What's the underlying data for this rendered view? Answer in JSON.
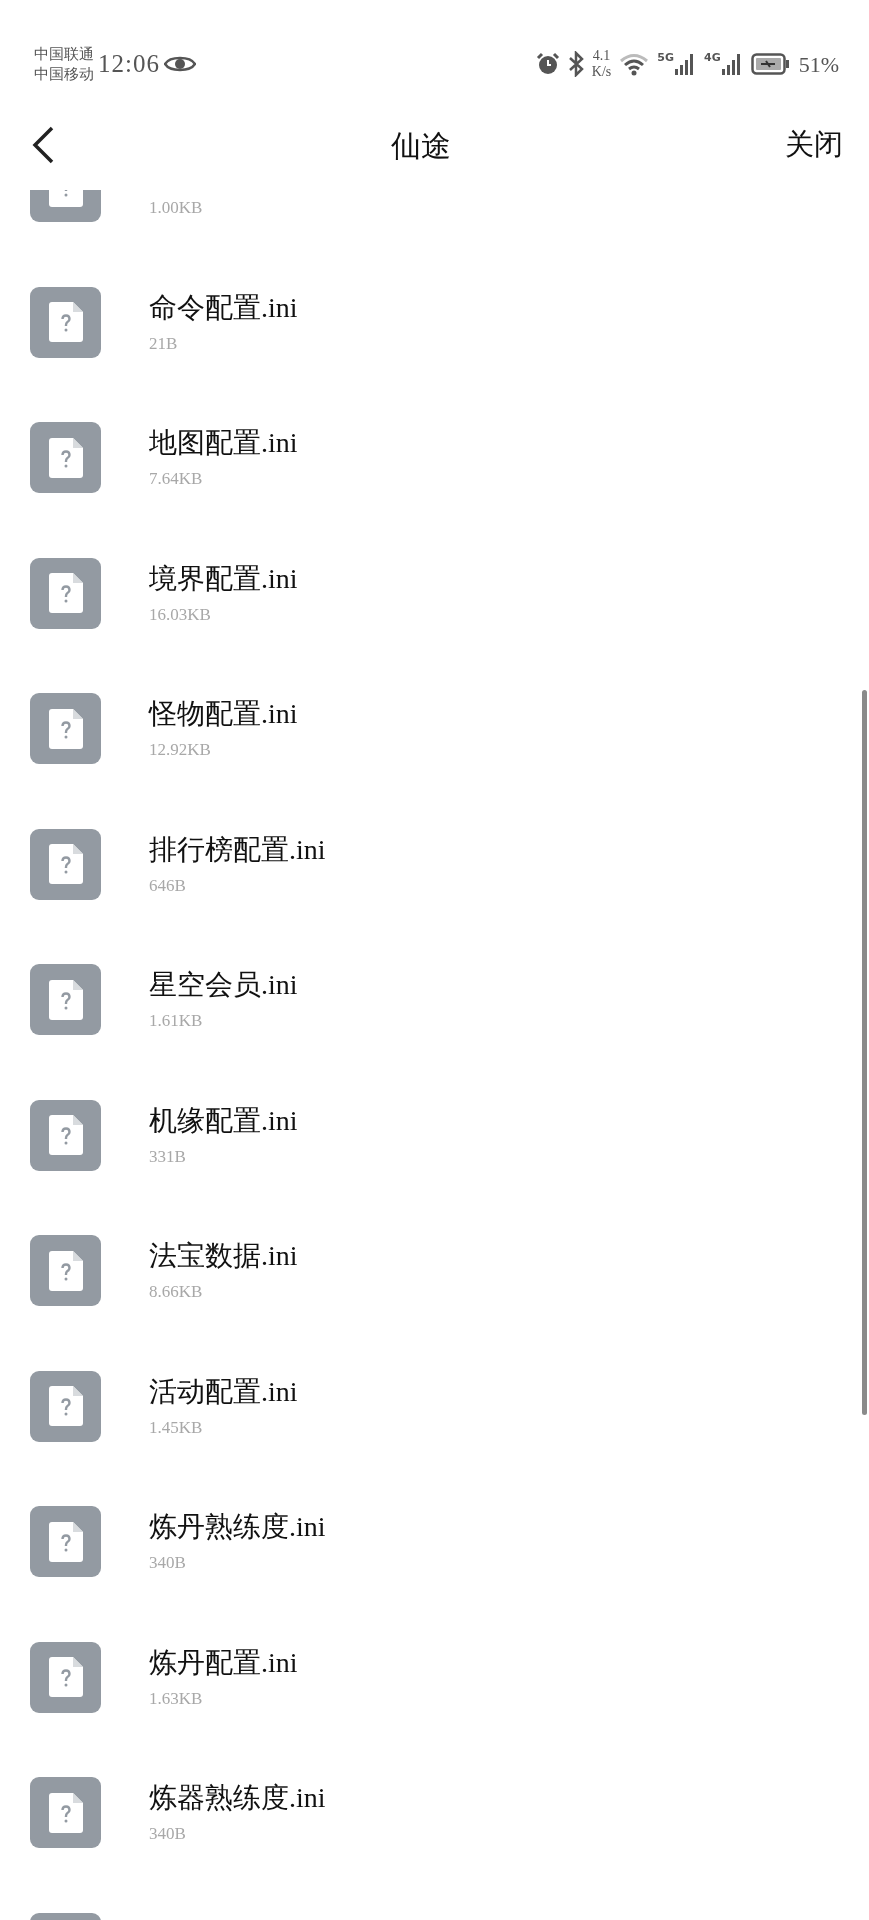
{
  "status_bar": {
    "carriers": [
      "中国联通",
      "中国移动"
    ],
    "time": "12:06",
    "net_speed": [
      "4.1",
      "K/s"
    ],
    "signal_labels": [
      "5G",
      "4G"
    ],
    "battery": "51%"
  },
  "header": {
    "title": "仙途",
    "close": "关闭"
  },
  "files": [
    {
      "size": "1.00KB"
    },
    {
      "name": "命令配置.ini",
      "size": "21B"
    },
    {
      "name": "地图配置.ini",
      "size": "7.64KB"
    },
    {
      "name": "境界配置.ini",
      "size": "16.03KB"
    },
    {
      "name": "怪物配置.ini",
      "size": "12.92KB"
    },
    {
      "name": "排行榜配置.ini",
      "size": "646B"
    },
    {
      "name": "星空会员.ini",
      "size": "1.61KB"
    },
    {
      "name": "机缘配置.ini",
      "size": "331B"
    },
    {
      "name": "法宝数据.ini",
      "size": "8.66KB"
    },
    {
      "name": "活动配置.ini",
      "size": "1.45KB"
    },
    {
      "name": "炼丹熟练度.ini",
      "size": "340B"
    },
    {
      "name": "炼丹配置.ini",
      "size": "1.63KB"
    },
    {
      "name": "炼器熟练度.ini",
      "size": "340B"
    }
  ]
}
